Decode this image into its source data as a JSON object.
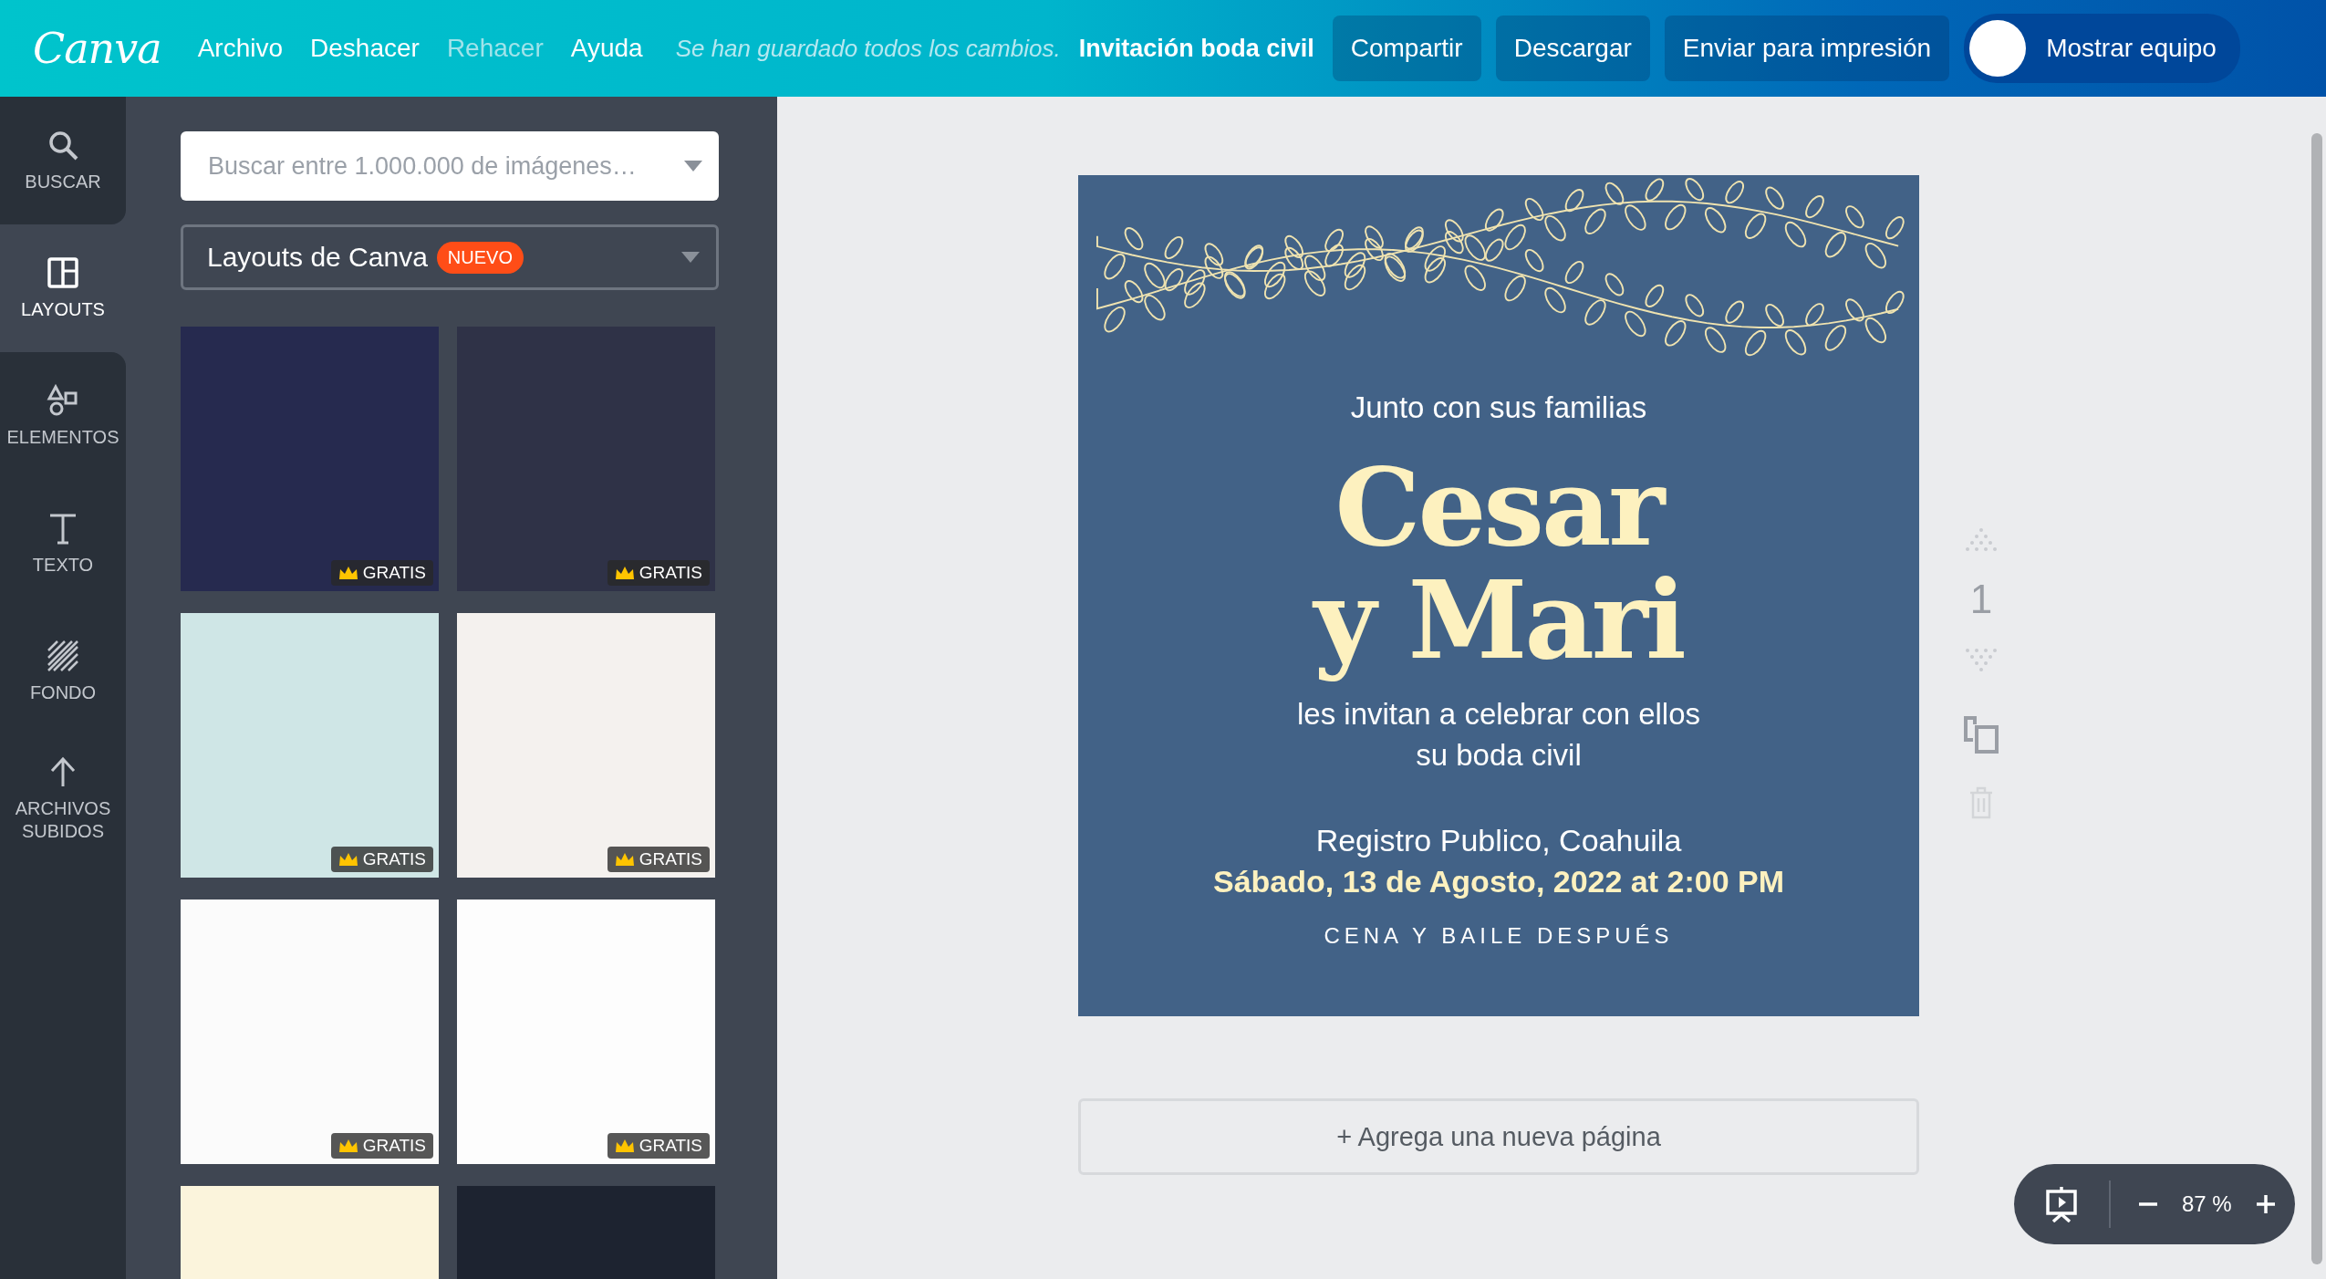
{
  "topbar": {
    "logo": "Canva",
    "menu": [
      {
        "label": "Archivo",
        "disabled": false
      },
      {
        "label": "Deshacer",
        "disabled": false
      },
      {
        "label": "Rehacer",
        "disabled": true
      },
      {
        "label": "Ayuda",
        "disabled": false
      }
    ],
    "save_status": "Se han guardado todos los cambios.",
    "document_title": "Invitación boda civil",
    "buttons": [
      "Compartir",
      "Descargar",
      "Enviar para impresión"
    ],
    "team_toggle": {
      "label": "Mostrar equipo"
    }
  },
  "sidebar": {
    "items": [
      {
        "label": "BUSCAR",
        "selected": false
      },
      {
        "label": "LAYOUTS",
        "selected": true
      },
      {
        "label": "ELEMENTOS",
        "selected": false
      },
      {
        "label": "TEXTO",
        "selected": false
      },
      {
        "label": "FONDO",
        "selected": false
      },
      {
        "label": "ARCHIVOS SUBIDOS",
        "selected": false
      }
    ]
  },
  "panel": {
    "search": {
      "placeholder": "Buscar entre 1.000.000 de imágenes…"
    },
    "category": {
      "label": "Layouts de Canva",
      "badge": "NUEVO"
    },
    "templates": [
      {
        "color": "#262a4f",
        "badge": "GRATIS"
      },
      {
        "color": "#2f3247",
        "badge": "GRATIS"
      },
      {
        "color": "#cfe6e6",
        "badge": "GRATIS"
      },
      {
        "color": "#f4f1ee",
        "badge": "GRATIS"
      },
      {
        "color": "#fbfbfb",
        "badge": "GRATIS"
      },
      {
        "color": "#fdfdfd",
        "badge": "GRATIS"
      },
      {
        "color": "#fbf4dc"
      },
      {
        "color": "#1d2330"
      }
    ]
  },
  "design": {
    "lines": [
      {
        "kind": "intro",
        "text": "Junto con sus familias"
      },
      {
        "kind": "names",
        "text": "Cesar"
      },
      {
        "kind": "names",
        "text": "y Mari"
      },
      {
        "kind": "body",
        "text": "les invitan a celebrar con ellos"
      },
      {
        "kind": "body",
        "text": "su boda civil"
      },
      {
        "kind": "place",
        "text": "Registro Publico, Coahuila"
      },
      {
        "kind": "date",
        "text": "Sábado, 13 de Agosto, 2022 at 2:00 PM"
      },
      {
        "kind": "caps",
        "text": "CENA Y BAILE DESPUÉS"
      }
    ]
  },
  "page_controls": {
    "page_number": "1"
  },
  "add_page": "+ Agrega una nueva página",
  "zoom": {
    "value": "87 %"
  }
}
